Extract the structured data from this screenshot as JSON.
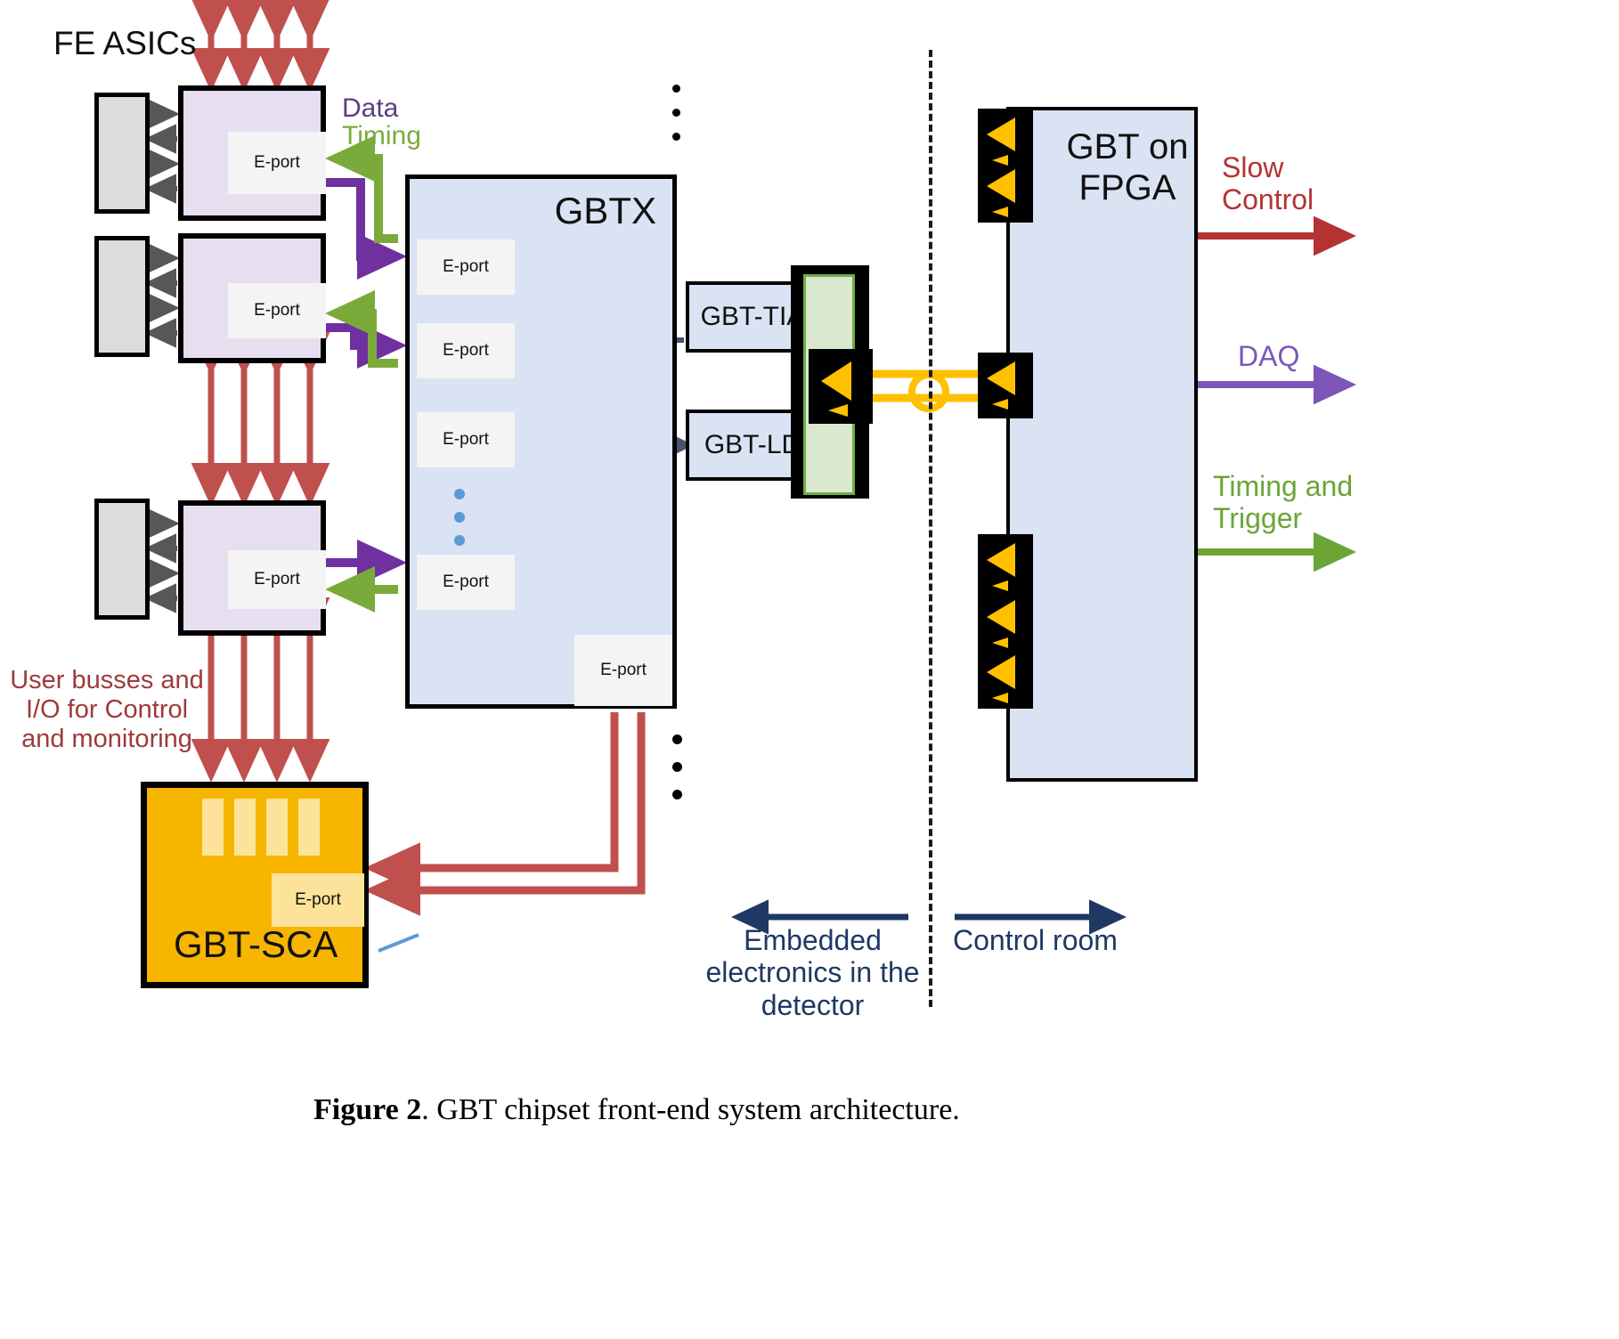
{
  "figure": {
    "caption_prefix": "Figure 2",
    "caption_text": ". GBT chipset front-end system architecture."
  },
  "labels": {
    "fe_asics": "FE ASICs",
    "data": "Data",
    "timing": "Timing",
    "gbtx": "GBTX",
    "gbt_tia": "GBT-TIA",
    "gbt_ld": "GBT-LD",
    "gbt_on_fpga_line1": "GBT on",
    "gbt_on_fpga_line2": "FPGA",
    "gbt_sca": "GBT-SCA",
    "eport": "E-port",
    "user_busses": "User busses and\nI/O for  Control\nand monitoring",
    "slow_control": "Slow\nControl",
    "daq": "DAQ",
    "timing_and_trigger": "Timing and\nTrigger",
    "embedded": "Embedded\nelectronics in the\ndetector",
    "control_room": "Control room"
  },
  "colors": {
    "data_purple": "#7030a0",
    "timing_green": "#7aab3a",
    "control_red": "#c0504d",
    "slow_control_red": "#b53234",
    "daq_purple": "#7c56b8",
    "trigger_green": "#6aa536",
    "navy": "#1f3864",
    "fiber_orange": "#ffc000",
    "optics_black": "#000000",
    "gbtx_fill": "#dae3f3",
    "fe_purple_fill": "#e7dff0",
    "fe_gray_fill": "#dcdcdc",
    "sca_fill": "#f7b500",
    "sca_pin_fill": "#fde39a",
    "eport_fill": "#f4f4f4",
    "dashed_gray": "#46536b",
    "green_optics_fill": "#d9e8cf"
  },
  "fe_modules": [
    {
      "id": "fe-1",
      "eport": "E-port"
    },
    {
      "id": "fe-2",
      "eport": "E-port"
    },
    {
      "id": "fe-3",
      "eport": "E-port"
    }
  ],
  "gbtx_eports": [
    {
      "id": "gbtx-eport-1",
      "label": "E-port"
    },
    {
      "id": "gbtx-eport-2",
      "label": "E-port"
    },
    {
      "id": "gbtx-eport-3",
      "label": "E-port"
    },
    {
      "id": "gbtx-eport-4",
      "label": "E-port"
    },
    {
      "id": "gbtx-eport-bottom",
      "label": "E-port"
    }
  ],
  "optical_modules": [
    {
      "id": "tia",
      "label": "GBT-TIA"
    },
    {
      "id": "ld",
      "label": "GBT-LD"
    }
  ],
  "right_links": [
    {
      "id": "slow-control",
      "label": "Slow\nControl",
      "color": "#b53234"
    },
    {
      "id": "daq",
      "label": "DAQ",
      "color": "#7c56b8"
    },
    {
      "id": "timing-trigger",
      "label": "Timing and\nTrigger",
      "color": "#6aa536"
    }
  ],
  "regions": [
    {
      "id": "embedded",
      "label": "Embedded\nelectronics in the\ndetector"
    },
    {
      "id": "control-room",
      "label": "Control room"
    }
  ]
}
